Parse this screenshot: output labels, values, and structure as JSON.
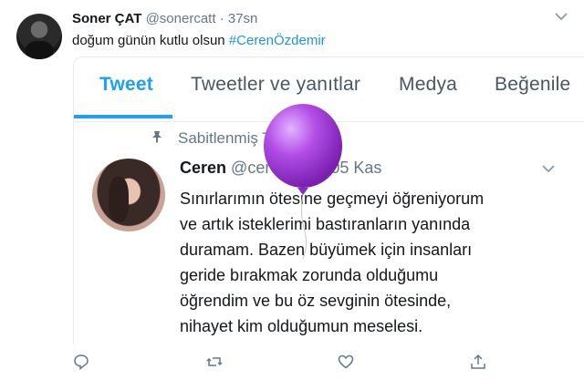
{
  "outer_tweet": {
    "name": "Soner ÇAT",
    "handle": "@sonercatt",
    "separator": "·",
    "time": "37sn",
    "text_plain": "doğum günün kutlu olsun ",
    "hashtag": "#CerenÖzdemir"
  },
  "tabs": [
    {
      "label": "Tweet",
      "active": true
    },
    {
      "label": "Tweetler ve yanıtlar",
      "active": false
    },
    {
      "label": "Medya",
      "active": false
    },
    {
      "label": "Beğenile",
      "active": false
    }
  ],
  "pinned_label": "Sabitlenmiş Tweet",
  "inner_tweet": {
    "name": "Ceren",
    "handle": "@cerenzmr",
    "separator": "·",
    "date": "05 Kas",
    "lines": [
      "Sınırlarımın ötesine geçmeyi öğreniyorum",
      "ve artık isteklerimi bastıranların yanında",
      "duramam. Bazen büyümek için insanları",
      "geride bırakmak zorunda olduğumu",
      "öğrendim ve bu öz sevginin ötesinde,",
      "nihayet kim olduğumun meselesi."
    ]
  },
  "icons": {
    "pin": "pin-icon",
    "reply": "reply-icon",
    "retweet": "retweet-icon",
    "like": "heart-icon",
    "share": "share-icon",
    "menu": "chevron-down-icon"
  },
  "colors": {
    "accent": "#1da1f2",
    "hashtag": "#1b95e0",
    "muted": "#657786",
    "balloon": "#b24de6"
  }
}
